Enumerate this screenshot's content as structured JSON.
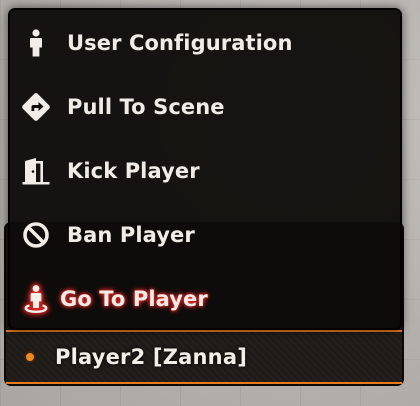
{
  "context_menu": {
    "items": [
      {
        "label": "User Configuration",
        "icon": "user-icon"
      },
      {
        "label": "Pull To Scene",
        "icon": "directions-sign-icon"
      },
      {
        "label": "Kick Player",
        "icon": "door-exit-icon"
      },
      {
        "label": "Ban Player",
        "icon": "ban-icon"
      },
      {
        "label": "Go To Player",
        "icon": "street-view-icon",
        "highlighted": true
      }
    ]
  },
  "players": {
    "entries": [
      {
        "name": "Player2 [Zanna]",
        "color": "#ee8a22"
      }
    ]
  },
  "colors": {
    "menu_background": "#0e0c0a",
    "menu_text": "#f1ede6",
    "highlight_glow": "#ff2a2a",
    "player_row_border": "#e87a1e"
  }
}
